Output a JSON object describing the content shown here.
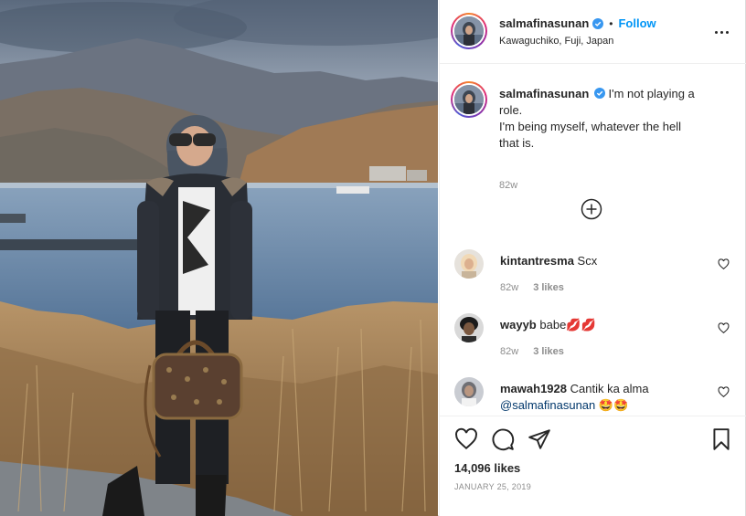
{
  "post": {
    "author": "salmafinasunan",
    "follow_label": "Follow",
    "separator": "•",
    "location": "Kawaguchiko, Fuji, Japan",
    "caption_lines": [
      "I'm not playing a role.",
      "I'm being myself, whatever the hell",
      "that is."
    ],
    "caption_time": "82w",
    "likes": "14,096 likes",
    "date": "JANUARY 25, 2019"
  },
  "comments": [
    {
      "username": "kintantresma",
      "text": "Scx",
      "time": "82w",
      "likes": "3 likes"
    },
    {
      "username": "wayyb",
      "text": "babe💋💋",
      "time": "82w",
      "likes": "3 likes"
    },
    {
      "username": "mawah1928",
      "text": "Cantik ka alma",
      "mention": "@salmafinasunan",
      "emoji": "🤩🤩"
    }
  ],
  "icons": {
    "more": "more-options-icon",
    "verified": "verified-badge-icon",
    "load_more": "plus-circle-icon",
    "heart": "heart-outline-icon",
    "comment": "speech-bubble-icon",
    "share": "paper-plane-icon",
    "save": "bookmark-icon"
  },
  "colors": {
    "accent": "#0095f6",
    "text": "#262626",
    "muted": "#8e8e8e",
    "verified": "#3897f0",
    "mention": "#00376b",
    "border": "#efefef"
  }
}
